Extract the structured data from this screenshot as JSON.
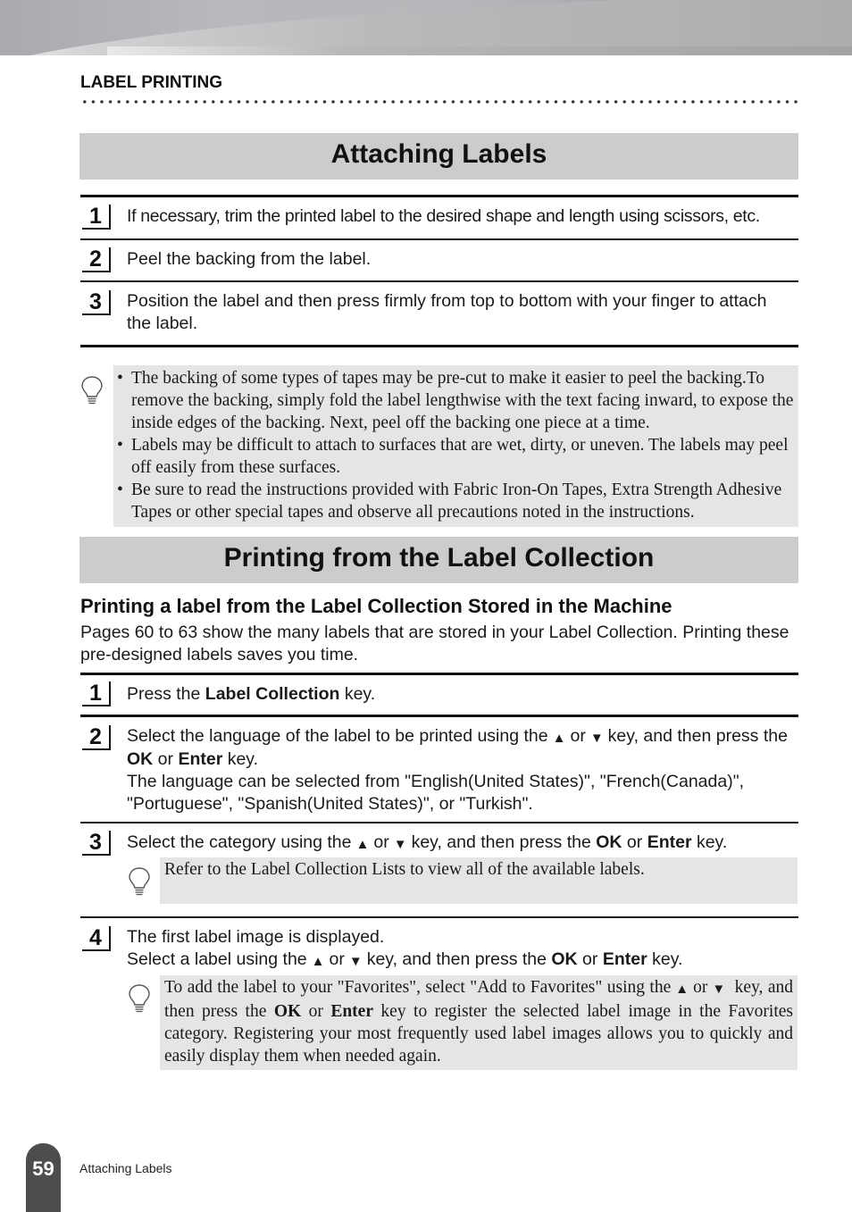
{
  "header": {
    "section_label": "LABEL PRINTING"
  },
  "attaching": {
    "title": "Attaching Labels",
    "steps": [
      {
        "number": "1",
        "text": "If necessary, trim the printed label to the desired shape and length using scissors, etc."
      },
      {
        "number": "2",
        "text": "Peel the backing from the label."
      },
      {
        "number": "3",
        "text": "Position the label and then press firmly from top to bottom with your finger to attach the label."
      }
    ],
    "note_icon": "lightbulb-icon",
    "notes": [
      "The backing of some types of tapes may be pre-cut to make it easier to peel the backing.To remove the backing, simply fold the label lengthwise with the text facing inward, to expose the inside edges of the backing. Next, peel off the backing one piece at a time.",
      "Labels may be difficult to attach to surfaces that are wet, dirty, or uneven. The labels may peel off easily from these surfaces.",
      "Be sure to read the instructions provided with Fabric Iron-On Tapes, Extra Strength Adhesive Tapes or other special tapes and observe all precautions noted in the instructions."
    ]
  },
  "collection": {
    "title": "Printing from the Label Collection",
    "subheading": "Printing a label from the Label Collection Stored in the Machine",
    "intro": "Pages 60 to 63 show the many labels that are stored in your Label Collection.  Printing these pre-designed labels saves you time.",
    "up_arrow": "▲",
    "down_arrow": "▼",
    "steps": [
      {
        "number": "1",
        "parts": {
          "a": "Press the ",
          "b": "Label Collection",
          "c": " key."
        }
      },
      {
        "number": "2",
        "parts": {
          "a": "Select the language of the label to be printed using the",
          "or": "or",
          "b": "key, and then press the ",
          "ok": "OK",
          "or2": " or ",
          "enter": "Enter",
          "c": " key.",
          "d": "The language can be selected from \"English(United States)\", \"French(Canada)\", \"Portuguese\", \"Spanish(United States)\", or \"Turkish\"."
        }
      },
      {
        "number": "3",
        "parts": {
          "a": "Select the category using the",
          "or": "or",
          "b": "key, and then press the ",
          "ok": "OK",
          "or2": " or ",
          "enter": "Enter",
          "c": " key."
        },
        "note": "Refer to the Label Collection Lists to view all of the available labels."
      },
      {
        "number": "4",
        "parts": {
          "a": "The first label image is displayed.",
          "b": "Select a label using the",
          "or": "or",
          "c": "key, and then press the ",
          "ok": "OK",
          "or2": " or ",
          "enter": "Enter",
          "d": " key."
        },
        "note": {
          "a": "To add the label to your \"Favorites\", select \"Add to Favorites\" using the",
          "or": "or",
          "b": " key, and then press the ",
          "ok": "OK",
          "or2": " or ",
          "enter": "Enter",
          "c": " key to register the selected label image in the Favorites category. Registering your most frequently used label images allows you to quickly and easily display them when needed again."
        }
      }
    ]
  },
  "footer": {
    "page_number": "59",
    "section": "Attaching Labels"
  }
}
